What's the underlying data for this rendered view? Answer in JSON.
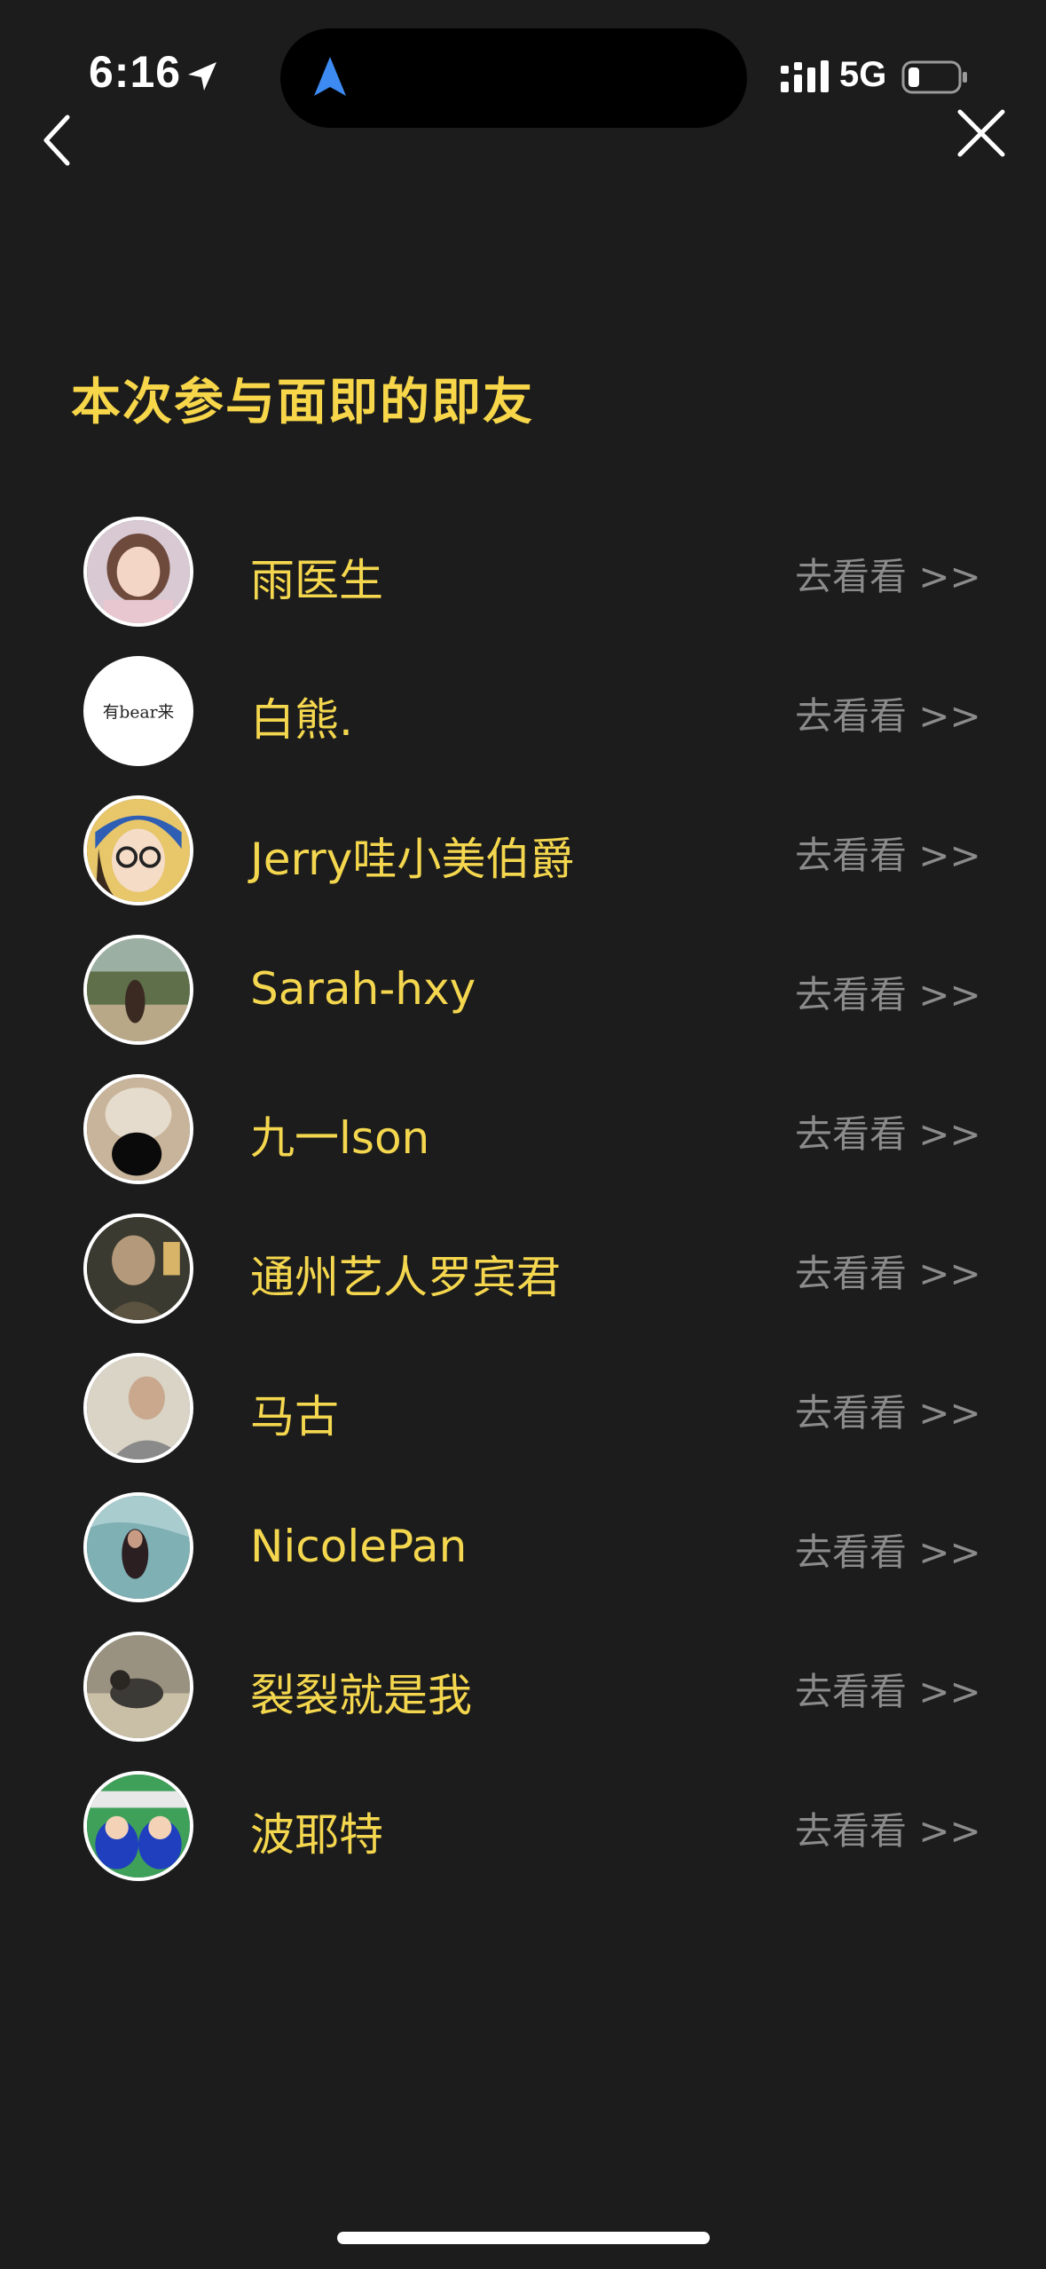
{
  "status_bar": {
    "time": "6:16",
    "network": "5G",
    "icons": [
      "location-arrow-icon",
      "navigation-arrow-icon",
      "signal-bars-icon",
      "battery-icon"
    ]
  },
  "nav": {
    "back_icon": "chevron-left-icon",
    "close_icon": "close-icon"
  },
  "title": "本次参与面即的即友",
  "friends": [
    {
      "name": "雨医生",
      "link": "去看看 >>"
    },
    {
      "name": "白熊.",
      "link": "去看看 >>",
      "avatar_text": "有bear来"
    },
    {
      "name": "Jerry哇小美伯爵",
      "link": "去看看 >>"
    },
    {
      "name": "Sarah-hxy",
      "link": "去看看 >>"
    },
    {
      "name": "九一lson",
      "link": "去看看 >>"
    },
    {
      "name": "通州艺人罗宾君",
      "link": "去看看 >>"
    },
    {
      "name": "马古",
      "link": "去看看 >>"
    },
    {
      "name": "NicolePan",
      "link": "去看看 >>"
    },
    {
      "name": "裂裂就是我",
      "link": "去看看 >>"
    },
    {
      "name": "波耶特",
      "link": "去看看 >>"
    }
  ],
  "colors": {
    "background": "#1c1c1c",
    "accent_yellow": "#f7d64a",
    "link_gray": "#8b8b8b",
    "navigation_blue": "#3d8bf2"
  }
}
